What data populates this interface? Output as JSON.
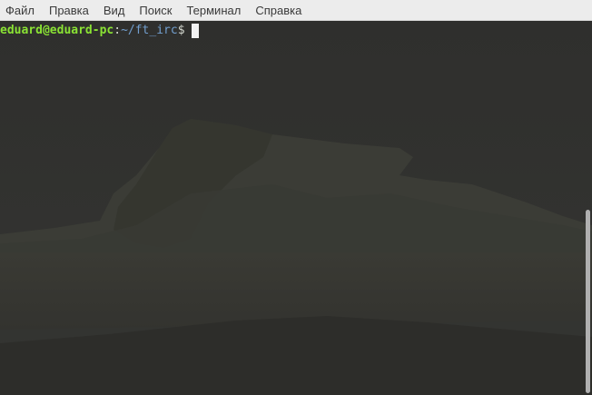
{
  "menubar": {
    "items": [
      {
        "label": "Файл"
      },
      {
        "label": "Правка"
      },
      {
        "label": "Вид"
      },
      {
        "label": "Поиск"
      },
      {
        "label": "Терминал"
      },
      {
        "label": "Справка"
      }
    ]
  },
  "terminal": {
    "prompt": {
      "user_host": "eduard@eduard-pc",
      "separator": ":",
      "path": "~/ft_irc",
      "symbol": "$"
    },
    "background": "mountain-wallpaper",
    "colors": {
      "user_host": "#8ae234",
      "path": "#729fcf",
      "text": "#d3d7cf",
      "cursor": "#f2f2f2"
    }
  }
}
